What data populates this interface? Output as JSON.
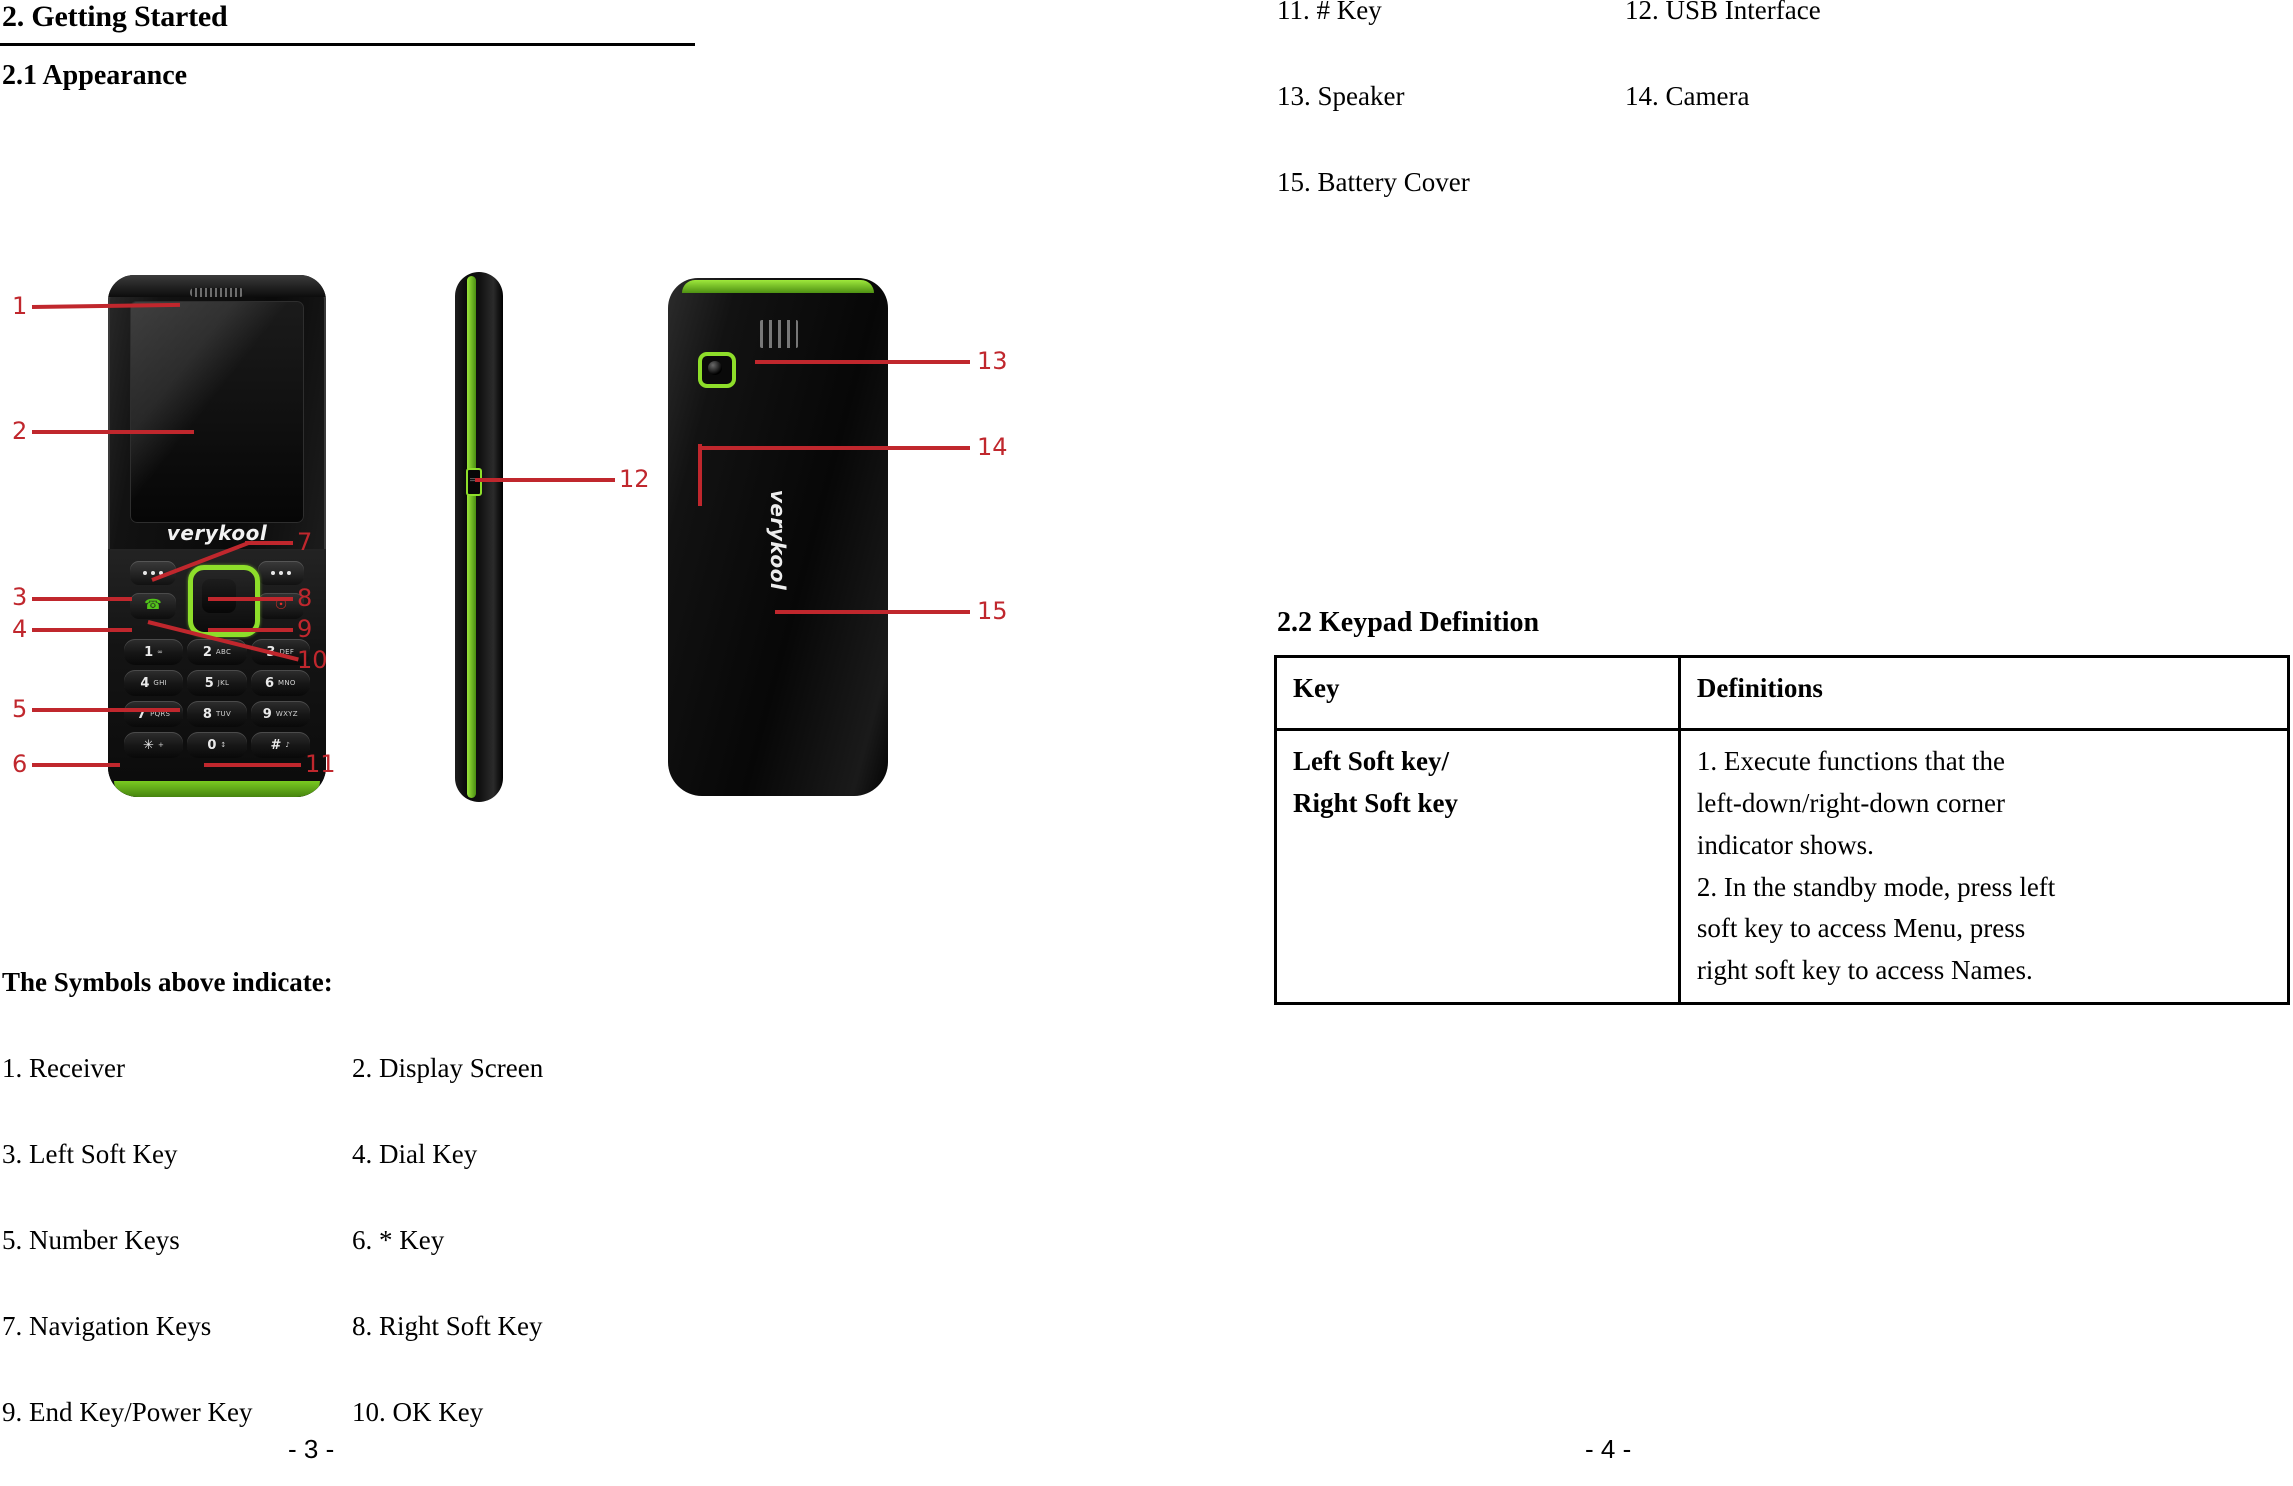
{
  "document": {
    "left_page": {
      "section_heading": "2. Getting Started",
      "sub_heading": "2.1 Appearance",
      "symbols_intro": "The Symbols above indicate:",
      "symbols": [
        {
          "left": "1. Receiver",
          "right": "2. Display Screen"
        },
        {
          "left": "3. Left Soft Key",
          "right": "4. Dial Key"
        },
        {
          "left": "5. Number Keys",
          "right": "6. * Key"
        },
        {
          "left": "7. Navigation Keys",
          "right": "8. Right Soft Key"
        },
        {
          "left": "9. End Key/Power Key",
          "right": "10. OK Key"
        }
      ],
      "page_number": "- 3 -"
    },
    "right_page": {
      "symbols": [
        {
          "left": "11. # Key",
          "right": "12. USB Interface"
        },
        {
          "left": "13. Speaker",
          "right": "14. Camera"
        },
        {
          "left": "15. Battery Cover",
          "right": ""
        }
      ],
      "sub_heading": "2.2 Keypad Definition",
      "table": {
        "headers": [
          "Key",
          "Definitions"
        ],
        "rows": [
          {
            "key_lines": [
              "Left Soft key/",
              "Right Soft key"
            ],
            "definition_lines": [
              "1. Execute functions that the",
              "left-down/right-down corner",
              "indicator shows.",
              "2. In the standby mode, press left",
              "soft key to access Menu, press",
              "right soft key to access Names."
            ]
          }
        ]
      },
      "page_number": "- 4 -"
    }
  },
  "figure": {
    "brand": "verykool",
    "brand_back": "verykool",
    "callouts_front": [
      "1",
      "2",
      "3",
      "4",
      "5",
      "6",
      "7",
      "8",
      "9",
      "10",
      "11"
    ],
    "callouts_side": [
      "12"
    ],
    "callouts_back": [
      "13",
      "14",
      "15"
    ],
    "keypad": [
      {
        "big": "1",
        "sml": "∞"
      },
      {
        "big": "2",
        "sml": "ABC"
      },
      {
        "big": "3",
        "sml": "DEF"
      },
      {
        "big": "4",
        "sml": "GHI"
      },
      {
        "big": "5",
        "sml": "JKL"
      },
      {
        "big": "6",
        "sml": "MNO"
      },
      {
        "big": "7",
        "sml": "PQRS"
      },
      {
        "big": "8",
        "sml": "TUV"
      },
      {
        "big": "9",
        "sml": "WXYZ"
      },
      {
        "big": "✳",
        "sml": "+"
      },
      {
        "big": "0",
        "sml": "↕"
      },
      {
        "big": "#",
        "sml": "♪"
      }
    ],
    "colors": {
      "callout": "#c0272d",
      "accent_green": "#8ede2a",
      "body_black": "#0a0a0a"
    }
  }
}
